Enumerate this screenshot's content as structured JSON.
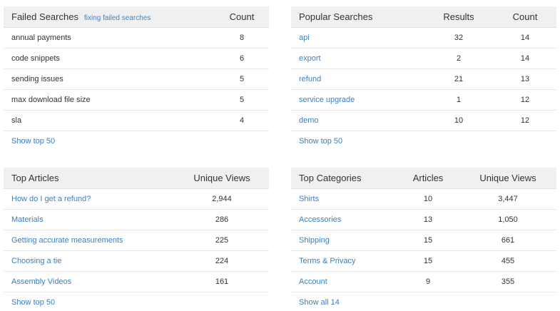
{
  "failed_searches": {
    "title": "Failed Searches",
    "help_link": "fixing failed searches",
    "columns": [
      "Count"
    ],
    "rows": [
      {
        "term": "annual payments",
        "count": "8"
      },
      {
        "term": "code snippets",
        "count": "6"
      },
      {
        "term": "sending issues",
        "count": "5"
      },
      {
        "term": "max download file size",
        "count": "5"
      },
      {
        "term": "sla",
        "count": "4"
      }
    ],
    "footer": "Show top 50"
  },
  "popular_searches": {
    "title": "Popular Searches",
    "columns": [
      "Results",
      "Count"
    ],
    "rows": [
      {
        "term": "api",
        "results": "32",
        "count": "14"
      },
      {
        "term": "export",
        "results": "2",
        "count": "14"
      },
      {
        "term": "refund",
        "results": "21",
        "count": "13"
      },
      {
        "term": "service upgrade",
        "results": "1",
        "count": "12"
      },
      {
        "term": "demo",
        "results": "10",
        "count": "12"
      }
    ],
    "footer": "Show top 50"
  },
  "top_articles": {
    "title": "Top Articles",
    "columns": [
      "Unique Views"
    ],
    "rows": [
      {
        "name": "How do I get a refund?",
        "views": "2,944"
      },
      {
        "name": "Materials",
        "views": "286"
      },
      {
        "name": "Getting accurate measurements",
        "views": "225"
      },
      {
        "name": "Choosing a tie",
        "views": "224"
      },
      {
        "name": "Assembly Videos",
        "views": "161"
      }
    ],
    "footer": "Show top 50"
  },
  "top_categories": {
    "title": "Top Categories",
    "columns": [
      "Articles",
      "Unique Views"
    ],
    "rows": [
      {
        "name": "Shirts",
        "articles": "10",
        "views": "3,447"
      },
      {
        "name": "Accessories",
        "articles": "13",
        "views": "1,050"
      },
      {
        "name": "Shipping",
        "articles": "15",
        "views": "661"
      },
      {
        "name": "Terms & Privacy",
        "articles": "15",
        "views": "455"
      },
      {
        "name": "Account",
        "articles": "9",
        "views": "355"
      }
    ],
    "footer": "Show all 14"
  }
}
